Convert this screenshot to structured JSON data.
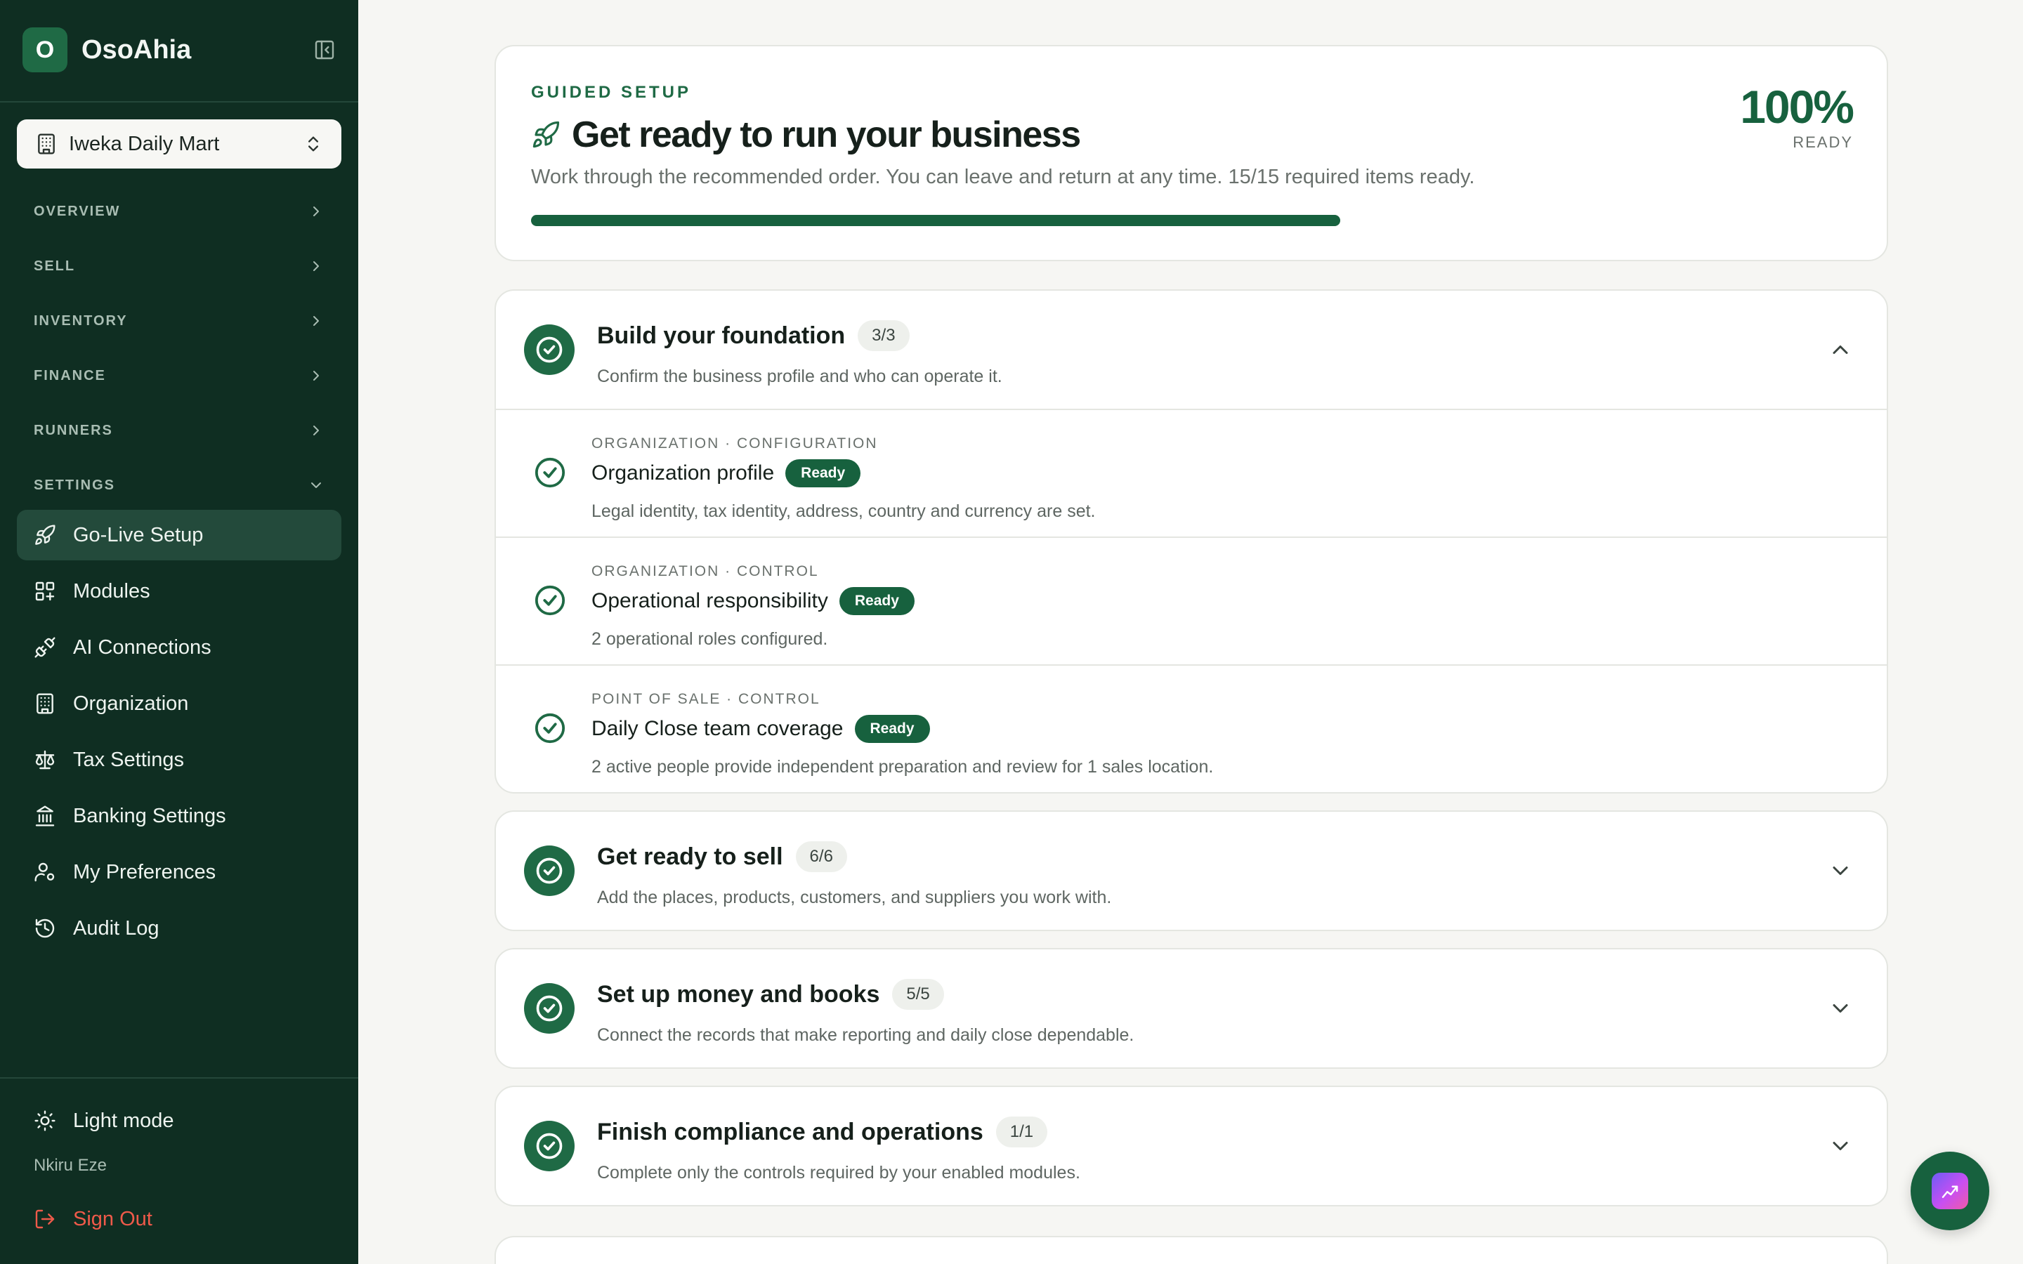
{
  "brand": {
    "logo_letter": "O",
    "name": "OsoAhia"
  },
  "org_switcher": {
    "label": "Iweka Daily Mart"
  },
  "nav": {
    "sections": [
      {
        "label": "OVERVIEW"
      },
      {
        "label": "SELL"
      },
      {
        "label": "INVENTORY"
      },
      {
        "label": "FINANCE"
      },
      {
        "label": "RUNNERS"
      },
      {
        "label": "SETTINGS"
      }
    ],
    "settings_items": [
      {
        "label": "Go-Live Setup",
        "icon": "rocket-icon",
        "active": true
      },
      {
        "label": "Modules",
        "icon": "modules-icon"
      },
      {
        "label": "AI Connections",
        "icon": "plug-icon"
      },
      {
        "label": "Organization",
        "icon": "building-icon"
      },
      {
        "label": "Tax Settings",
        "icon": "scale-icon"
      },
      {
        "label": "Banking Settings",
        "icon": "bank-icon"
      },
      {
        "label": "My Preferences",
        "icon": "user-cog-icon"
      },
      {
        "label": "Audit Log",
        "icon": "history-icon"
      }
    ]
  },
  "footer": {
    "theme_toggle": "Light mode",
    "user_name": "Nkiru Eze",
    "sign_out": "Sign Out"
  },
  "hero": {
    "eyebrow": "GUIDED SETUP",
    "title": "Get ready to run your business",
    "description": "Work through the recommended order. You can leave and return at any time. 15/15 required items ready.",
    "percent_text": "100%",
    "percent_label": "READY",
    "progress": 1.0
  },
  "steps": [
    {
      "title": "Build your foundation",
      "count": "3/3",
      "description": "Confirm the business profile and who can operate it.",
      "expanded": true,
      "items": [
        {
          "kicker": "ORGANIZATION · CONFIGURATION",
          "title": "Organization profile",
          "badge": "Ready",
          "description": "Legal identity, tax identity, address, country and currency are set."
        },
        {
          "kicker": "ORGANIZATION · CONTROL",
          "title": "Operational responsibility",
          "badge": "Ready",
          "description": "2 operational roles configured."
        },
        {
          "kicker": "POINT OF SALE · CONTROL",
          "title": "Daily Close team coverage",
          "badge": "Ready",
          "description": "2 active people provide independent preparation and review for 1 sales location."
        }
      ]
    },
    {
      "title": "Get ready to sell",
      "count": "6/6",
      "description": "Add the places, products, customers, and suppliers you work with.",
      "expanded": false
    },
    {
      "title": "Set up money and books",
      "count": "5/5",
      "description": "Connect the records that make reporting and daily close dependable.",
      "expanded": false
    },
    {
      "title": "Finish compliance and operations",
      "count": "1/1",
      "description": "Complete only the controls required by your enabled modules.",
      "expanded": false
    }
  ],
  "colors": {
    "sidebar_bg": "#0f2e22",
    "accent_green": "#17613e",
    "sign_out_red": "#ef5a4a"
  }
}
